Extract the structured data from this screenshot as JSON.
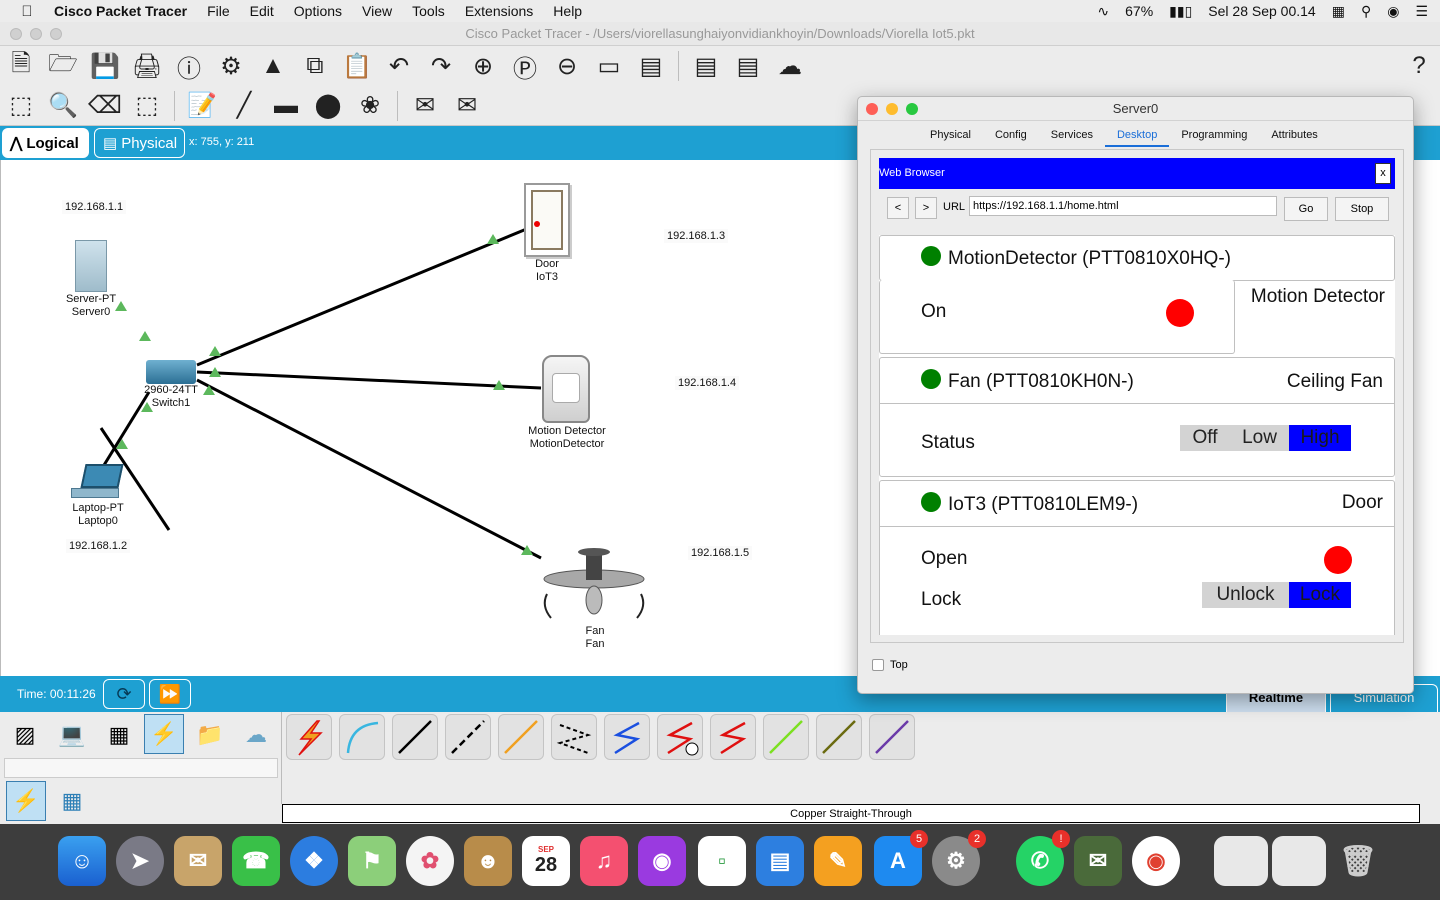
{
  "menubar": {
    "app_name": "Cisco Packet Tracer",
    "menus": [
      "File",
      "Edit",
      "Options",
      "View",
      "Tools",
      "Extensions",
      "Help"
    ],
    "battery": "67%",
    "clock": "Sel 28 Sep  00.14"
  },
  "window": {
    "title": "Cisco Packet Tracer - /Users/viorellasunghaiyonvidiankhoyin/Downloads/Viorella Iot5.pkt"
  },
  "workspace_tabs": {
    "logical": "Logical",
    "physical": "Physical",
    "coords": "x: 755, y: 211"
  },
  "devices": {
    "server": {
      "type": "Server-PT",
      "name": "Server0",
      "ip": "192.168.1.1"
    },
    "switch": {
      "type": "2960-24TT",
      "name": "Switch1"
    },
    "laptop": {
      "type": "Laptop-PT",
      "name": "Laptop0",
      "ip": "192.168.1.2"
    },
    "door": {
      "type": "Door",
      "name": "IoT3",
      "ip": "192.168.1.3"
    },
    "motion": {
      "type": "Motion Detector",
      "name": "MotionDetector",
      "ip": "192.168.1.4"
    },
    "fan": {
      "type": "Fan",
      "name": "Fan",
      "ip": "192.168.1.5"
    }
  },
  "bottombar": {
    "time": "Time: 00:11:26",
    "realtime": "Realtime",
    "simulation": "Simulation",
    "cable_label": "Copper Straight-Through"
  },
  "server_window": {
    "title": "Server0",
    "tabs": [
      "Physical",
      "Config",
      "Services",
      "Desktop",
      "Programming",
      "Attributes"
    ],
    "active_tab": "Desktop",
    "browser_title": "Web Browser",
    "close": "x",
    "back": "<",
    "forward": ">",
    "url_label": "URL",
    "url": "https://192.168.1.1/home.html",
    "go": "Go",
    "stop": "Stop",
    "top_checkbox": "Top",
    "cards": {
      "motion": {
        "title": "MotionDetector (PTT0810X0HQ-)",
        "kind": "Motion Detector",
        "state_label": "On",
        "state_color": "#ff0000",
        "status_color": "#008000"
      },
      "fan": {
        "title": "Fan (PTT0810KH0N-)",
        "kind": "Ceiling Fan",
        "state_label": "Status",
        "options": [
          "Off",
          "Low",
          "High"
        ],
        "selected": "High",
        "status_color": "#008000"
      },
      "door": {
        "title": "IoT3 (PTT0810LEM9-)",
        "kind": "Door",
        "open_label": "Open",
        "open_color": "#ff0000",
        "lock_label": "Lock",
        "lock_options": [
          "Unlock",
          "Lock"
        ],
        "lock_selected": "Lock",
        "status_color": "#008000"
      }
    }
  },
  "dock": {
    "badges": {
      "appstore": "5",
      "preferences": "2",
      "whatsapp": "!"
    },
    "calendar_month": "SEP",
    "calendar_day": "28"
  },
  "colors": {
    "accent_blue": "#1ea0d2",
    "selected_blue": "#0000ff",
    "link_green": "#5cb85c"
  }
}
